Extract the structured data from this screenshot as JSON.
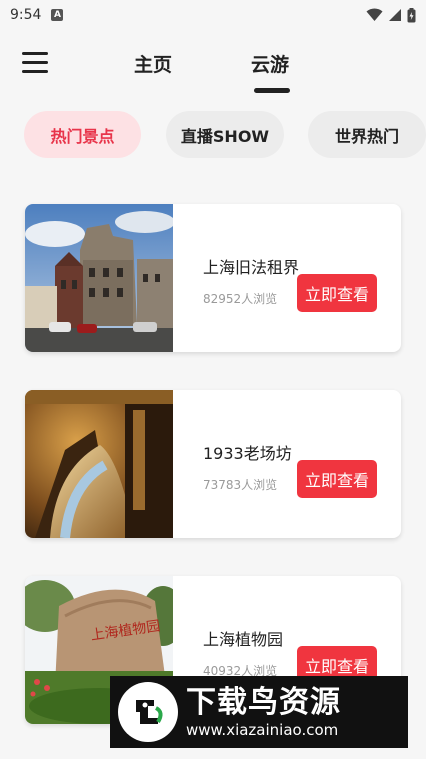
{
  "status_bar": {
    "time": "9:54",
    "notification_icon_letter": "A"
  },
  "nav": {
    "tabs": [
      {
        "label": "主页"
      },
      {
        "label": "云游"
      }
    ],
    "active_tab": "云游"
  },
  "categories": [
    {
      "label": "热门景点",
      "active": true
    },
    {
      "label": "直播SHOW",
      "active": false
    },
    {
      "label": "世界热门",
      "active": false
    }
  ],
  "attractions": [
    {
      "name": "上海旧法租界",
      "views": "82952人浏览",
      "button": "立即查看"
    },
    {
      "name": "1933老场坊",
      "views": "73783人浏览",
      "button": "立即查看"
    },
    {
      "name": "上海植物园",
      "views": "40932人浏览",
      "button": "立即查看"
    }
  ],
  "watermark": {
    "title": "下载鸟资源",
    "url": "www.xiazainiao.com"
  },
  "colors": {
    "accent": "#f0353f",
    "chip_active_bg": "#fde1e4",
    "chip_active_text": "#e8344a"
  }
}
